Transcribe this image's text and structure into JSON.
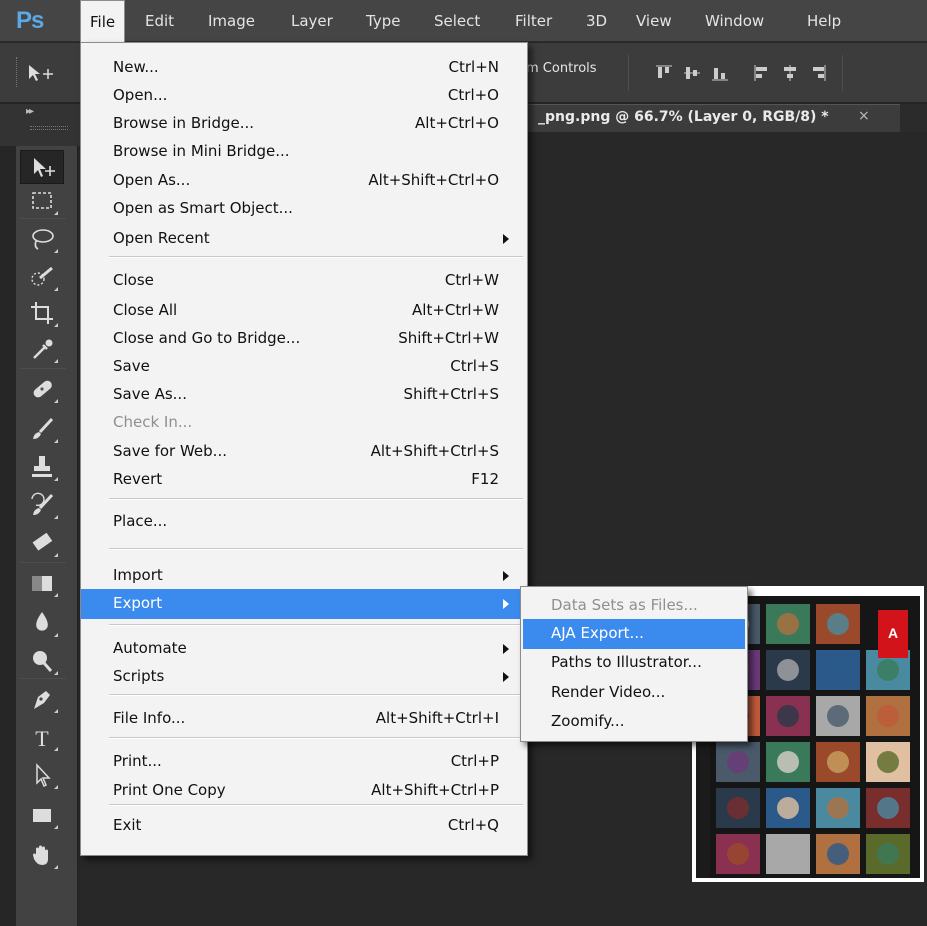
{
  "app": {
    "logo": "Ps"
  },
  "menubar": {
    "items": [
      "File",
      "Edit",
      "Image",
      "Layer",
      "Type",
      "Select",
      "Filter",
      "3D",
      "View",
      "Window",
      "Help"
    ],
    "active": "File"
  },
  "options_bar": {
    "label": "m Controls"
  },
  "document_tab": {
    "title": "_png.png @ 66.7% (Layer 0, RGB/8) *",
    "close": "×"
  },
  "file_menu": {
    "items": [
      {
        "label": "New...",
        "shortcut": "Ctrl+N"
      },
      {
        "label": "Open...",
        "shortcut": "Ctrl+O"
      },
      {
        "label": "Browse in Bridge...",
        "shortcut": "Alt+Ctrl+O"
      },
      {
        "label": "Browse in Mini Bridge...",
        "shortcut": ""
      },
      {
        "label": "Open As...",
        "shortcut": "Alt+Shift+Ctrl+O"
      },
      {
        "label": "Open as Smart Object...",
        "shortcut": ""
      },
      {
        "label": "Open Recent",
        "shortcut": "",
        "submenu": true
      },
      {
        "label": "Close",
        "shortcut": "Ctrl+W"
      },
      {
        "label": "Close All",
        "shortcut": "Alt+Ctrl+W"
      },
      {
        "label": "Close and Go to Bridge...",
        "shortcut": "Shift+Ctrl+W"
      },
      {
        "label": "Save",
        "shortcut": "Ctrl+S"
      },
      {
        "label": "Save As...",
        "shortcut": "Shift+Ctrl+S"
      },
      {
        "label": "Check In...",
        "shortcut": "",
        "disabled": true
      },
      {
        "label": "Save for Web...",
        "shortcut": "Alt+Shift+Ctrl+S"
      },
      {
        "label": "Revert",
        "shortcut": "F12"
      },
      {
        "label": "Place...",
        "shortcut": ""
      },
      {
        "label": "Import",
        "shortcut": "",
        "submenu": true
      },
      {
        "label": "Export",
        "shortcut": "",
        "submenu": true,
        "highlighted": true
      },
      {
        "label": "Automate",
        "shortcut": "",
        "submenu": true
      },
      {
        "label": "Scripts",
        "shortcut": "",
        "submenu": true
      },
      {
        "label": "File Info...",
        "shortcut": "Alt+Shift+Ctrl+I"
      },
      {
        "label": "Print...",
        "shortcut": "Ctrl+P"
      },
      {
        "label": "Print One Copy",
        "shortcut": "Alt+Shift+Ctrl+P"
      },
      {
        "label": "Exit",
        "shortcut": "Ctrl+Q"
      }
    ]
  },
  "export_submenu": {
    "items": [
      {
        "label": "Data Sets as Files...",
        "disabled": true
      },
      {
        "label": "AJA Export...",
        "highlighted": true
      },
      {
        "label": "Paths to Illustrator..."
      },
      {
        "label": "Render Video..."
      },
      {
        "label": "Zoomify..."
      }
    ]
  },
  "toolbox": {
    "tools": [
      "move-tool-icon",
      "marquee-tool-icon",
      "lasso-tool-icon",
      "quick-selection-tool-icon",
      "crop-tool-icon",
      "eyedropper-tool-icon",
      "spot-healing-tool-icon",
      "brush-tool-icon",
      "clone-stamp-tool-icon",
      "history-brush-tool-icon",
      "eraser-tool-icon",
      "gradient-tool-icon",
      "blur-tool-icon",
      "dodge-tool-icon",
      "pen-tool-icon",
      "type-tool-icon",
      "path-selection-tool-icon",
      "rectangle-tool-icon",
      "hand-tool-icon"
    ]
  },
  "colors": {
    "menu_highlight": "#3b8bee",
    "ps_blue": "#5aa9e6",
    "panel_dark": "#262626"
  }
}
